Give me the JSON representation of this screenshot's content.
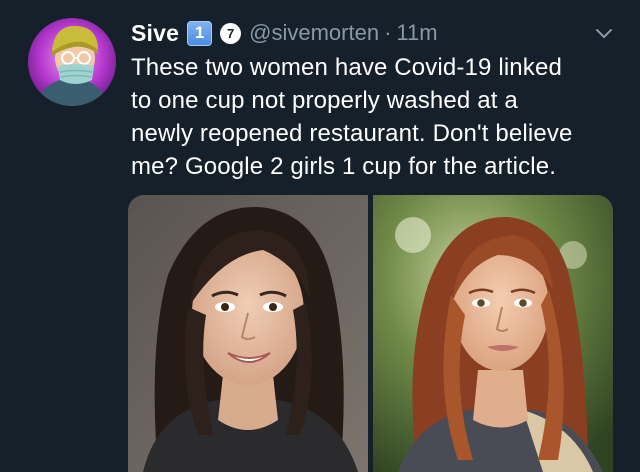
{
  "tweet": {
    "display_name": "Sive",
    "badge_one": "1",
    "badge_seven": "7",
    "handle": "@sivemorten",
    "separator": "·",
    "time": "11m",
    "text_lines": [
      "These two women have Covid-19 linked",
      "to one cup not properly washed at a",
      "newly reopened restaurant. Don't believe",
      "me? Google 2 girls 1 cup for the article."
    ]
  },
  "icons": {
    "avatar": "avatar-icon",
    "badge_one": "keycap-one-icon",
    "badge_seven": "circled-seven-icon",
    "menu": "chevron-down-icon"
  },
  "colors": {
    "background": "#15202b",
    "primary_text": "#ffffff",
    "secondary_text": "#8899a6"
  }
}
